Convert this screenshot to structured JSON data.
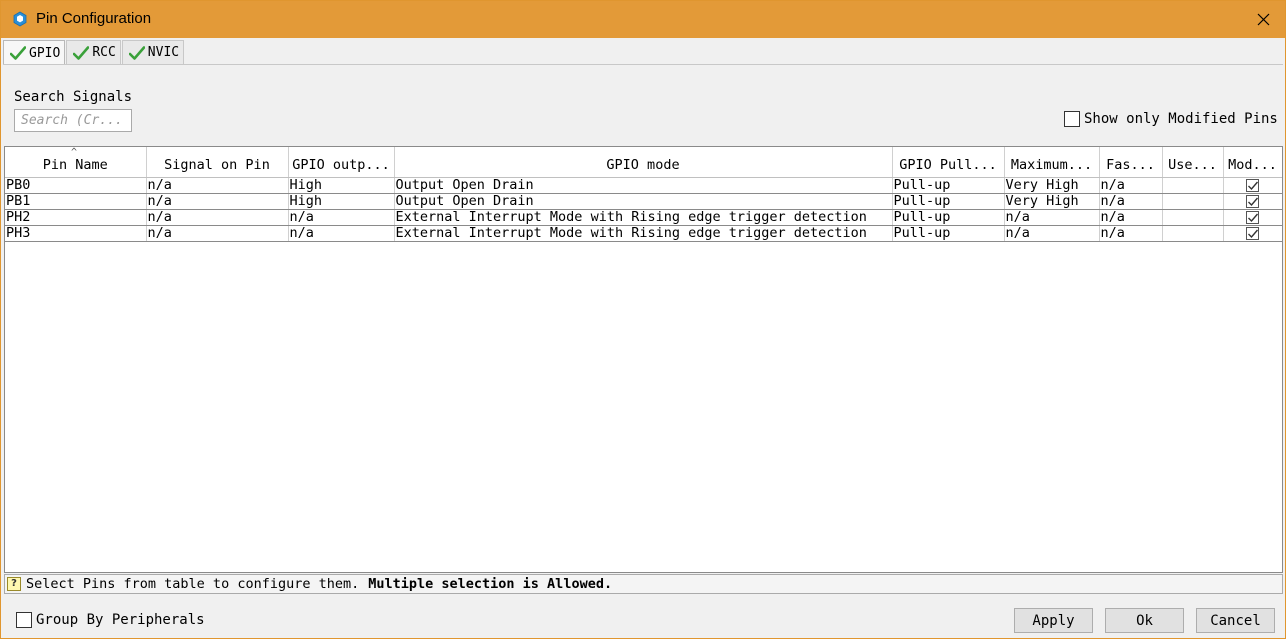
{
  "window": {
    "title": "Pin Configuration"
  },
  "tabs": [
    {
      "label": "GPIO",
      "active": true
    },
    {
      "label": "RCC",
      "active": false
    },
    {
      "label": "NVIC",
      "active": false
    }
  ],
  "search": {
    "label": "Search Signals",
    "placeholder": "Search (Cr..."
  },
  "filter": {
    "show_modified_label": "Show only Modified Pins",
    "show_modified_checked": false
  },
  "table": {
    "columns": [
      "Pin Name",
      "Signal on Pin",
      "GPIO outp...",
      "GPIO mode",
      "GPIO Pull...",
      "Maximum...",
      "Fas...",
      "Use...",
      "Mod..."
    ],
    "rows": [
      {
        "pin": "PB0",
        "signal": "n/a",
        "output": "High",
        "mode": "Output Open Drain",
        "pull": "Pull-up",
        "maximum": "Very High",
        "fast": "n/a",
        "user": "",
        "modified": true
      },
      {
        "pin": "PB1",
        "signal": "n/a",
        "output": "High",
        "mode": "Output Open Drain",
        "pull": "Pull-up",
        "maximum": "Very High",
        "fast": "n/a",
        "user": "",
        "modified": true
      },
      {
        "pin": "PH2",
        "signal": "n/a",
        "output": "n/a",
        "mode": "External Interrupt Mode with Rising edge trigger detection",
        "pull": "Pull-up",
        "maximum": "n/a",
        "fast": "n/a",
        "user": "",
        "modified": true
      },
      {
        "pin": "PH3",
        "signal": "n/a",
        "output": "n/a",
        "mode": "External Interrupt Mode with Rising edge trigger detection",
        "pull": "Pull-up",
        "maximum": "n/a",
        "fast": "n/a",
        "user": "",
        "modified": true
      }
    ]
  },
  "status": {
    "icon": "question-icon",
    "hint": "Select Pins from table to configure them.",
    "hint_bold": "Multiple selection is Allowed."
  },
  "footer": {
    "group_label": "Group By Peripherals",
    "group_checked": false,
    "apply_label": "Apply",
    "ok_label": "Ok",
    "cancel_label": "Cancel"
  },
  "colors": {
    "titlebar": "#e39a38",
    "check_green": "#3aa13a"
  }
}
